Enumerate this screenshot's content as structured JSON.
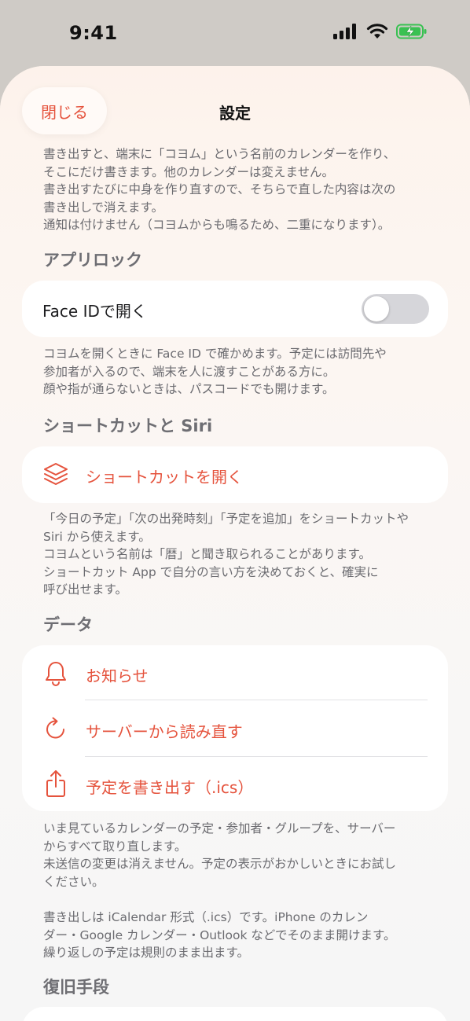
{
  "status_bar": {
    "time": "9:41"
  },
  "nav": {
    "close_label": "閉じる",
    "title": "設定"
  },
  "export_note": "書き出すと、端末に「コヨム」という名前のカレンダーを作り、\nそこにだけ書きます。他のカレンダーは変えません。\n書き出すたびに中身を作り直すので、そちらで直した内容は次の\n書き出しで消えます。\n通知は付けません（コヨムからも鳴るため、二重になります）。",
  "app_lock": {
    "header": "アプリロック",
    "face_id_label": "Face IDで開く",
    "face_id_enabled": false,
    "note": "コヨムを開くときに Face ID で確かめます。予定には訪問先や\n参加者が入るので、端末を人に渡すことがある方に。\n顔や指が通らないときは、パスコードでも開けます。"
  },
  "shortcuts": {
    "header": "ショートカットと Siri",
    "open_label": "ショートカットを開く",
    "open_icon": "layers-icon",
    "note": "「今日の予定」「次の出発時刻」「予定を追加」をショートカットや\nSiri から使えます。\nコヨムという名前は「暦」と聞き取られることがあります。\nショートカット App で自分の言い方を決めておくと、確実に\n呼び出せます。"
  },
  "data_section": {
    "header": "データ",
    "items": [
      {
        "label": "お知らせ",
        "icon": "bell-icon"
      },
      {
        "label": "サーバーから読み直す",
        "icon": "refresh-icon"
      },
      {
        "label": "予定を書き出す（.ics）",
        "icon": "share-icon"
      }
    ],
    "note": "いま見ているカレンダーの予定・参加者・グループを、サーバー\nからすべて取り直します。\n未送信の変更は消えません。予定の表示がおかしいときにお試し\nください。\n\n書き出しは iCalendar 形式（.ics）です。iPhone のカレン\nダー・Google カレンダー・Outlook などでそのまま開けます。\n繰り返しの予定は規則のまま出ます。"
  },
  "recovery": {
    "header": "復旧手段"
  },
  "colors": {
    "accent": "#e5533d",
    "toggle_off": "#d6d6da",
    "secondary_text": "#6b6b70"
  }
}
